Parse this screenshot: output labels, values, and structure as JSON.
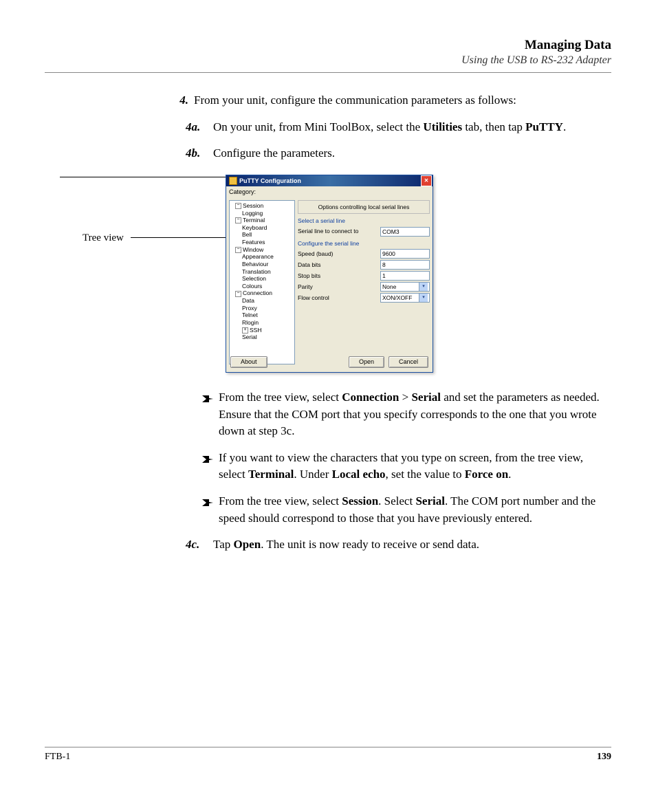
{
  "header": {
    "title": "Managing Data",
    "subtitle": "Using the USB to RS-232 Adapter"
  },
  "step4": {
    "num": "4.",
    "text": "From your unit, configure the communication parameters as follows:"
  },
  "step4a": {
    "num": "4a.",
    "pre": "On your unit, from Mini ToolBox, select the ",
    "b1": "Utilities",
    "mid": " tab, then tap ",
    "b2": "PuTTY",
    "post": "."
  },
  "step4b": {
    "num": "4b.",
    "text": "Configure the parameters."
  },
  "callout": "Tree view",
  "putty": {
    "title": "PuTTY Configuration",
    "category_label": "Category:",
    "tree": {
      "session": "Session",
      "logging": "Logging",
      "terminal": "Terminal",
      "keyboard": "Keyboard",
      "bell": "Bell",
      "features": "Features",
      "window": "Window",
      "appearance": "Appearance",
      "behaviour": "Behaviour",
      "translation": "Translation",
      "selection": "Selection",
      "colours": "Colours",
      "connection": "Connection",
      "data": "Data",
      "proxy": "Proxy",
      "telnet": "Telnet",
      "rlogin": "Rlogin",
      "ssh": "SSH",
      "serial": "Serial"
    },
    "panel_title": "Options controlling local serial lines",
    "group1": "Select a serial line",
    "serial_line_lbl": "Serial line to connect to",
    "serial_line_val": "COM3",
    "group2": "Configure the serial line",
    "speed_lbl": "Speed (baud)",
    "speed_val": "9600",
    "databits_lbl": "Data bits",
    "databits_val": "8",
    "stopbits_lbl": "Stop bits",
    "stopbits_val": "1",
    "parity_lbl": "Parity",
    "parity_val": "None",
    "flow_lbl": "Flow control",
    "flow_val": "XON/XOFF",
    "about_btn": "About",
    "open_btn": "Open",
    "cancel_btn": "Cancel"
  },
  "bullets": {
    "b1": {
      "pre": "From the tree view, select ",
      "bold1": "Connection",
      "mid1": " > ",
      "bold2": "Serial",
      "post": " and set the parameters as needed. Ensure that the COM port that you specify corresponds to the one that you wrote down at step 3c."
    },
    "b2": {
      "pre": "If you want to view the characters that you type on screen, from the tree view, select ",
      "bold1": "Terminal",
      "mid1": ". Under ",
      "bold2": "Local echo",
      "mid2": ", set the value to ",
      "bold3": "Force on",
      "post": "."
    },
    "b3": {
      "pre": "From the tree view, select ",
      "bold1": "Session",
      "mid1": ". Select ",
      "bold2": "Serial",
      "post": ". The COM port number and the speed should correspond to those that you have previously entered."
    }
  },
  "step4c": {
    "num": "4c.",
    "pre": "Tap ",
    "bold": "Open",
    "post": ". The unit is now ready to receive or send data."
  },
  "footer": {
    "left": "FTB-1",
    "right": "139"
  }
}
